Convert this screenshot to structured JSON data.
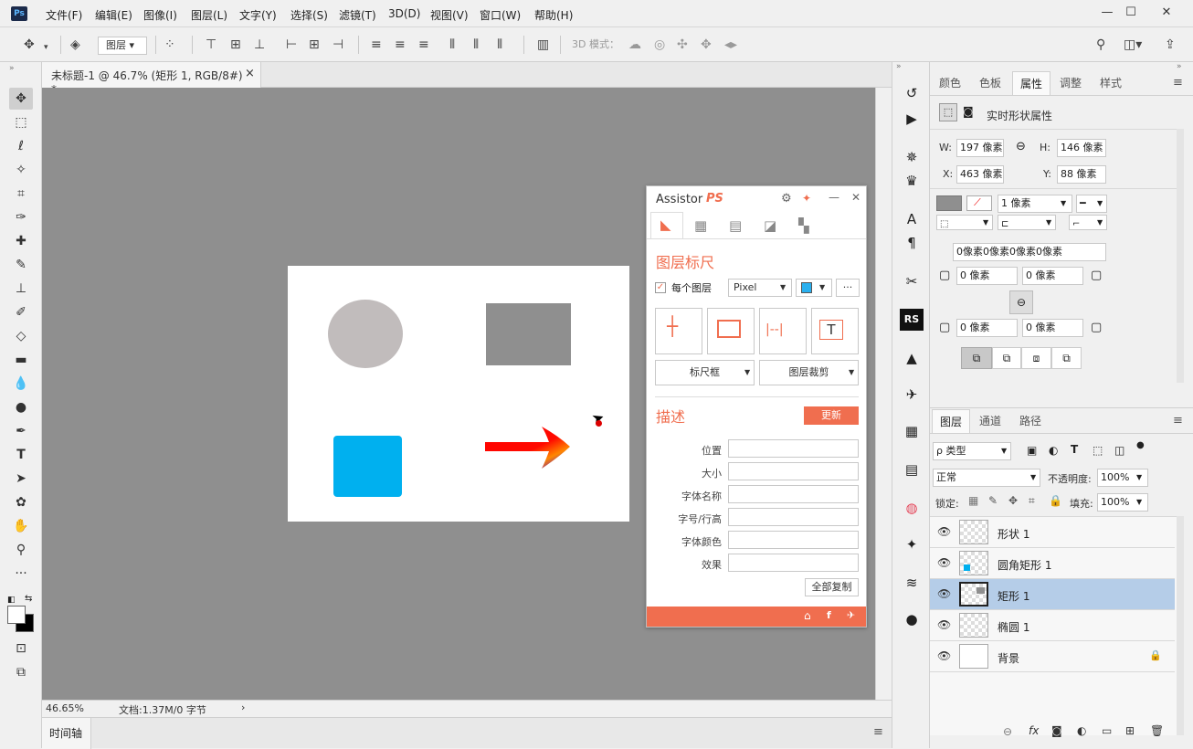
{
  "menubar": {
    "app_icon": "Ps",
    "menus": [
      "文件(F)",
      "编辑(E)",
      "图像(I)",
      "图层(L)",
      "文字(Y)",
      "选择(S)",
      "滤镜(T)",
      "3D(D)",
      "视图(V)",
      "窗口(W)",
      "帮助(H)"
    ],
    "win_min": "—",
    "win_max": "☐",
    "win_close": "✕"
  },
  "optionsbar": {
    "layer_select": "图层",
    "mode_3d_label": "3D 模式："
  },
  "document": {
    "tab_title": "未标题-1 @ 46.7% (矩形 1, RGB/8#) *",
    "tab_close": "×",
    "zoom": "46.65%",
    "doc_info": "文档:1.37M/0 字节",
    "timeline_label": "时间轴"
  },
  "assistant": {
    "title": "Assistor",
    "title_ps": "PS",
    "section_ruler": "图层标尺",
    "each_layer_label": "每个图层",
    "unit_select": "Pixel",
    "more_btn": "···",
    "ruler_frame_btn": "标尺框",
    "layer_crop_btn": "图层裁剪",
    "section_desc": "描述",
    "update_btn": "更新",
    "fields": [
      "位置",
      "大小",
      "字体名称",
      "字号/行高",
      "字体颜色",
      "效果"
    ],
    "copy_all_btn": "全部复制",
    "accent_color": "#f06e4f"
  },
  "properties": {
    "tabs": [
      "颜色",
      "色板",
      "属性",
      "调整",
      "样式"
    ],
    "active_tab": "属性",
    "header": "实时形状属性",
    "w_label": "W:",
    "w_value": "197 像素",
    "h_label": "H:",
    "h_value": "146 像素",
    "x_label": "X:",
    "x_value": "463 像素",
    "y_label": "Y:",
    "y_value": "88 像素",
    "stroke_width": "1 像素",
    "corner_radii": "0像素0像素0像素0像素",
    "radius_tl": "0 像素",
    "radius_tr": "0 像素",
    "radius_bl": "0 像素",
    "radius_br": "0 像素"
  },
  "layers_panel": {
    "tabs": [
      "图层",
      "通道",
      "路径"
    ],
    "active_tab": "图层",
    "filter_label": "ρ 类型",
    "blend_mode": "正常",
    "opacity_label": "不透明度:",
    "opacity_value": "100%",
    "lock_label": "锁定:",
    "fill_label": "填充:",
    "fill_value": "100%",
    "layers": [
      {
        "name": "形状 1",
        "selected": false
      },
      {
        "name": "圆角矩形 1",
        "selected": false
      },
      {
        "name": "矩形 1",
        "selected": true
      },
      {
        "name": "椭圆 1",
        "selected": false
      },
      {
        "name": "背景",
        "selected": false
      }
    ],
    "footer_fx": "fx"
  },
  "canvas_shapes": {
    "ellipse_color": "#c1bcbc",
    "rect_color": "#8f8f8f",
    "rounded_rect_color": "#00b0ef"
  },
  "selection_color": "#b5cde8"
}
